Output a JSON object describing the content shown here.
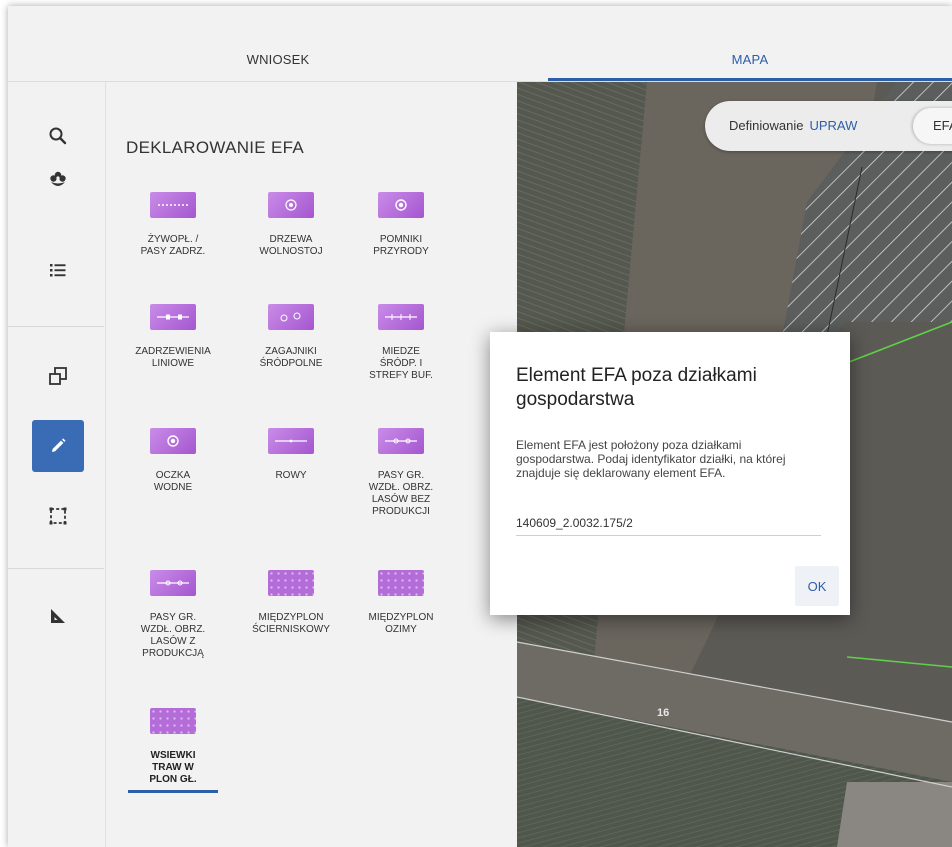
{
  "tabs": {
    "wniosek": "WNIOSEK",
    "mapa": "MAPA"
  },
  "sidebar": {
    "tools": [
      "search-icon",
      "flower-icon",
      "list-icon",
      "copy-icon",
      "pencil-icon",
      "select-area-icon",
      "ruler-triangle-icon"
    ],
    "active_tool": "pencil-icon"
  },
  "panel": {
    "title": "DEKLAROWANIE EFA",
    "items": [
      {
        "line1": "ŻYWOPŁ. /",
        "line2": "PASY ZADRZ.",
        "line3": "",
        "line4": ""
      },
      {
        "line1": "DRZEWA",
        "line2": "WOLNOSTOJ",
        "line3": "",
        "line4": ""
      },
      {
        "line1": "POMNIKI",
        "line2": "PRZYRODY",
        "line3": "",
        "line4": ""
      },
      {
        "line1": "ZADRZEWIENIA",
        "line2": "LINIOWE",
        "line3": "",
        "line4": ""
      },
      {
        "line1": "ZAGAJNIKI",
        "line2": "ŚRÓDPOLNE",
        "line3": "",
        "line4": ""
      },
      {
        "line1": "MIEDZE",
        "line2": "ŚRÓDP. I",
        "line3": "STREFY BUF.",
        "line4": ""
      },
      {
        "line1": "OCZKA",
        "line2": "WODNE",
        "line3": "",
        "line4": ""
      },
      {
        "line1": "ROWY",
        "line2": "",
        "line3": "",
        "line4": ""
      },
      {
        "line1": "PASY GR.",
        "line2": "WZDŁ. OBRZ.",
        "line3": "LASÓW BEZ",
        "line4": "PRODUKCJI"
      },
      {
        "line1": "PASY GR.",
        "line2": "WZDŁ. OBRZ.",
        "line3": "LASÓW Z",
        "line4": "PRODUKCJĄ"
      },
      {
        "line1": "MIĘDZYPLON",
        "line2": "ŚCIERNISKOWY",
        "line3": "",
        "line4": ""
      },
      {
        "line1": "MIĘDZYPLON",
        "line2": "OZIMY",
        "line3": "",
        "line4": ""
      },
      {
        "line1": "WSIEWKI",
        "line2": "TRAW W",
        "line3": "PLON GŁ.",
        "line4": ""
      }
    ],
    "selected_index": 12
  },
  "map": {
    "mode_label": "Definiowanie",
    "mode_value": "UPRAW",
    "efa_button": "EFA",
    "parcel_label": "16"
  },
  "dialog": {
    "title": "Element EFA poza działkami gospodarstwa",
    "body": "Element EFA jest położony poza działkami gospodarstwa. Podaj identyfikator działki, na której znajduje się deklarowany element EFA.",
    "input_value": "140609_2.0032.175/2",
    "ok_label": "OK"
  },
  "colors": {
    "accent": "#2d5ea8",
    "active_tool_bg": "#3a6bb5",
    "efa_swatch": "#b46dd8",
    "map_boundary_green": "#5fd04a"
  }
}
